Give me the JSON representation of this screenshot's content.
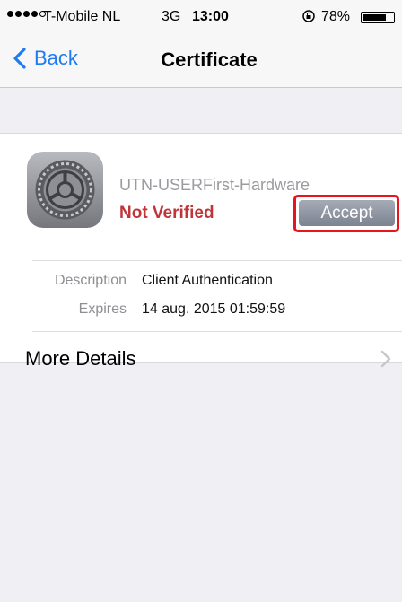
{
  "status_bar": {
    "carrier": "T-Mobile NL",
    "network": "3G",
    "time": "13:00",
    "battery_percent": "78%",
    "battery_level": 0.78,
    "signal_bars_filled": 4,
    "signal_bars_total": 5,
    "icons": [
      "signal-dots-icon",
      "rotation-lock-icon",
      "battery-icon"
    ]
  },
  "nav": {
    "back_label": "Back",
    "title": "Certificate",
    "icons": [
      "chevron-left-icon"
    ]
  },
  "certificate": {
    "name": "UTN-USERFirst-Hardware",
    "status": "Not Verified",
    "accept_label": "Accept",
    "icon": "settings-gear-icon",
    "details": [
      {
        "label": "Description",
        "value": "Client Authentication"
      },
      {
        "label": "Expires",
        "value": "14 aug. 2015 01:59:59"
      }
    ],
    "more_details_label": "More Details",
    "more_details_icon": "chevron-right-icon"
  },
  "colors": {
    "accent": "#1d7cf2",
    "warning": "#c0353a",
    "highlight": "#e8141e",
    "background": "#efeff4"
  }
}
